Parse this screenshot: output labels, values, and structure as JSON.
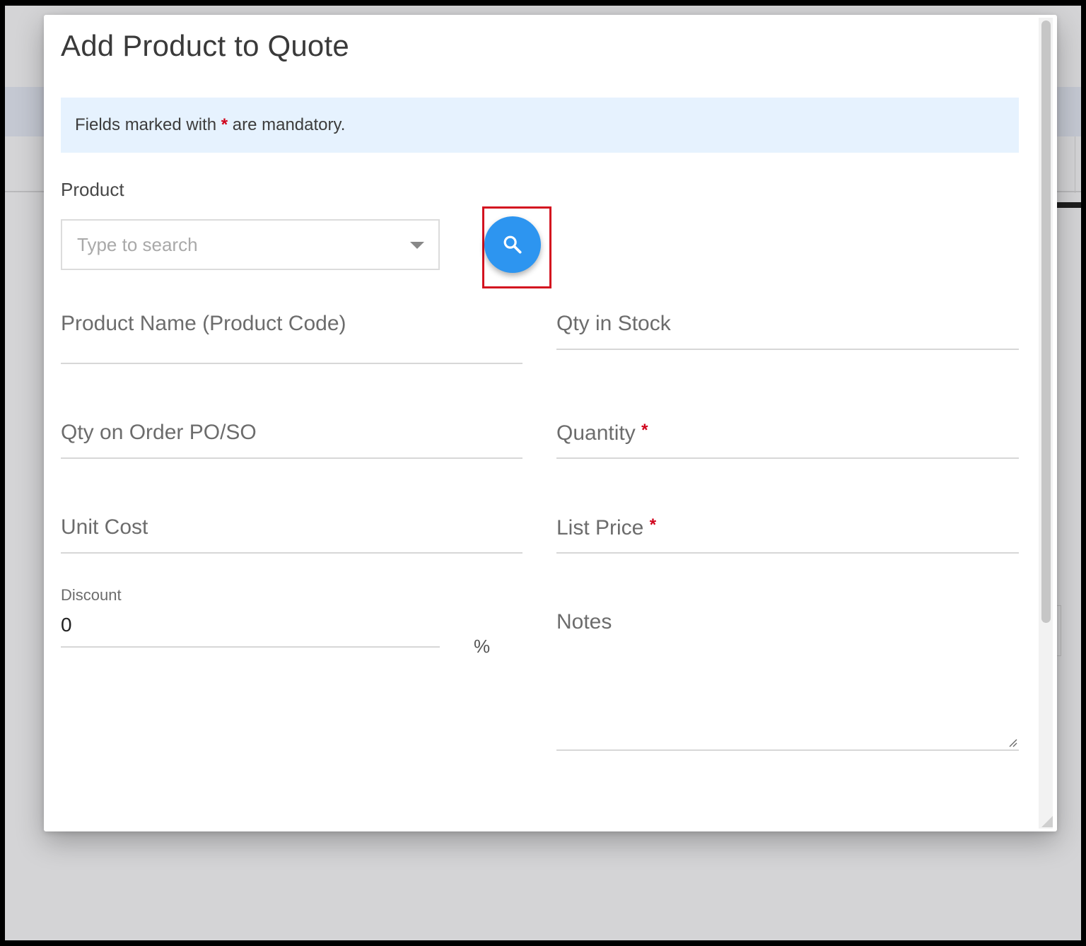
{
  "modal": {
    "title": "Add Product to Quote"
  },
  "banner": {
    "prefix": "Fields marked with",
    "asterisk": "*",
    "suffix": "are mandatory."
  },
  "product": {
    "label": "Product",
    "placeholder": "Type to search",
    "search_icon": "search-icon"
  },
  "fields": {
    "product_name": "Product Name (Product Code)",
    "qty_in_stock": "Qty in Stock",
    "qty_on_order": "Qty on Order PO/SO",
    "quantity": "Quantity",
    "unit_cost": "Unit Cost",
    "list_price": "List Price",
    "notes": "Notes",
    "required_marker": "*"
  },
  "discount": {
    "label": "Discount",
    "value": "0",
    "unit": "%"
  },
  "colors": {
    "accent": "#2d95f0",
    "highlight": "#d3121f",
    "required": "#d0021b",
    "banner_bg": "#e6f2fe"
  }
}
